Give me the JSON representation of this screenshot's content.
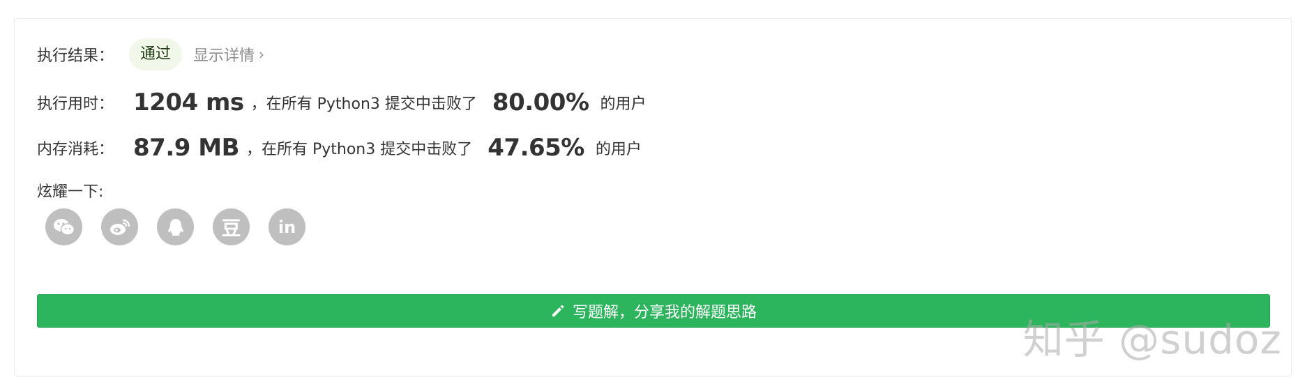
{
  "result": {
    "label": "执行结果：",
    "status": "通过",
    "details_link": "显示详情",
    "chevron": "›"
  },
  "runtime": {
    "label": "执行用时：",
    "value": "1204 ms",
    "middle_text": "，在所有 Python3 提交中击败了",
    "percent": "80.00%",
    "suffix": "的用户"
  },
  "memory": {
    "label": "内存消耗：",
    "value": "87.9 MB",
    "middle_text": "，在所有 Python3 提交中击败了",
    "percent": "47.65%",
    "suffix": "的用户"
  },
  "share": {
    "label": "炫耀一下:",
    "icons": [
      "wechat-icon",
      "weibo-icon",
      "qq-icon",
      "douban-icon",
      "linkedin-icon"
    ],
    "douban_glyph": "豆",
    "linkedin_glyph": "in"
  },
  "write_solution": {
    "label": "写题解，分享我的解题思路",
    "icon": "pencil-icon"
  },
  "watermark": "知乎 @sudoz",
  "colors": {
    "accent_green": "#2db55d",
    "pill_bg": "#f1f8ea",
    "icon_gray": "#bfbfbf"
  }
}
